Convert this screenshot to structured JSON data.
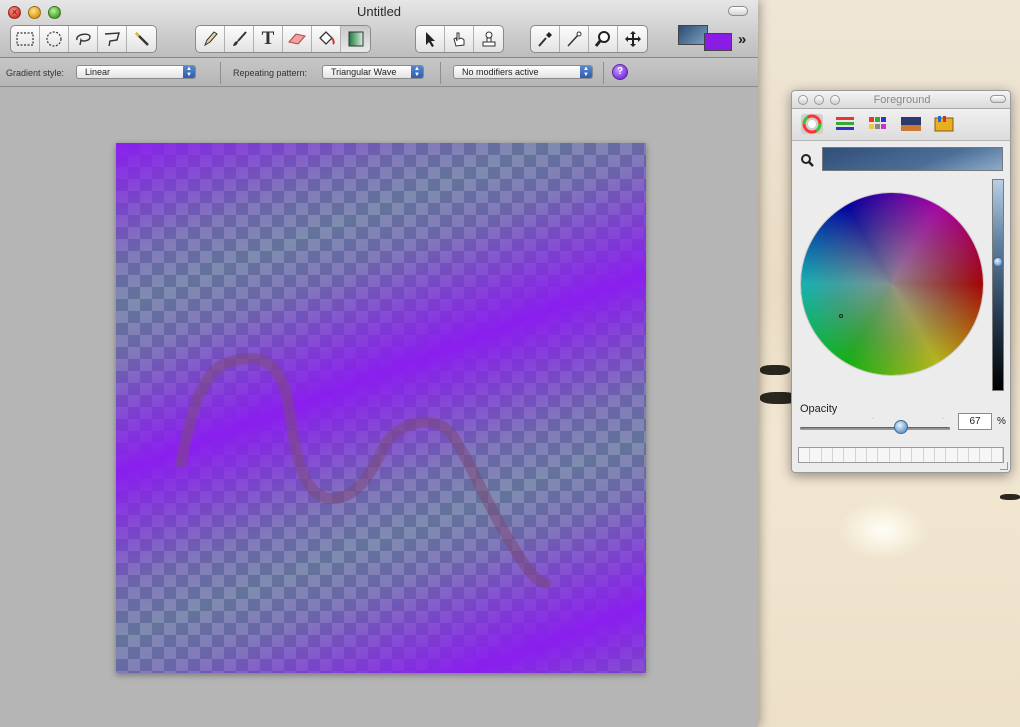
{
  "window": {
    "title": "Untitled"
  },
  "toolbar": {
    "selection_tools": [
      "rect-select-icon",
      "ellipse-select-icon",
      "lasso-icon",
      "polygon-lasso-icon",
      "magic-wand-icon"
    ],
    "paint_tools": [
      "pencil-icon",
      "paintbrush-icon",
      "text-icon",
      "eraser-icon",
      "paint-bucket-icon",
      "gradient-icon"
    ],
    "transform_tools": [
      "move-selection-icon",
      "hand-select-icon",
      "clone-stamp-icon"
    ],
    "misc_tools": [
      "eyedropper-icon",
      "smudge-icon",
      "zoom-icon",
      "pan-icon"
    ],
    "text_tool_glyph": "T",
    "more_glyph": "»"
  },
  "options": {
    "gradient_style_label": "Gradient style:",
    "gradient_style_value": "Linear",
    "repeating_pattern_label": "Repeating pattern:",
    "repeating_pattern_value": "Triangular Wave",
    "modifiers_value": "No modifiers active",
    "help_glyph": "?"
  },
  "colors": {
    "foreground": "#8a1ce6",
    "background_well": "#2c4c70",
    "gradient_color": "#8b1cf0"
  },
  "color_panel": {
    "title": "Foreground",
    "tabs": [
      "color-wheel-icon",
      "color-sliders-icon",
      "color-palettes-icon",
      "image-palettes-icon",
      "crayons-icon"
    ],
    "selected_color": "#2f4e78",
    "opacity_label": "Opacity",
    "opacity_value": "67",
    "opacity_unit": "%",
    "opacity_fraction": 0.67
  }
}
